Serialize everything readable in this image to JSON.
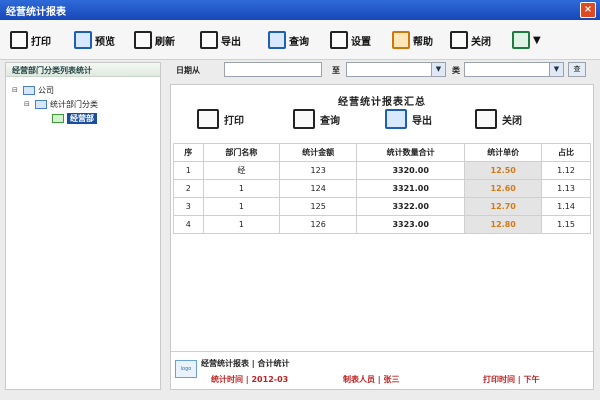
{
  "window": {
    "title": "经营统计报表",
    "close_glyph": "×"
  },
  "toolbar": {
    "buttons": [
      {
        "label": "打印",
        "icon": "print-icon"
      },
      {
        "label": "预览",
        "icon": "preview-icon"
      },
      {
        "label": "刷新",
        "icon": "refresh-icon"
      },
      {
        "label": "导出",
        "icon": "export-icon"
      },
      {
        "label": "查询",
        "icon": "query-icon"
      },
      {
        "label": "设置",
        "icon": "settings-icon"
      },
      {
        "label": "帮助",
        "icon": "help-icon"
      },
      {
        "label": "关闭",
        "icon": "close-doc-icon"
      }
    ]
  },
  "sidebar": {
    "header": "经营部门分类列表统计",
    "tree": [
      {
        "toggle": "⊟",
        "label": "公司",
        "level": 0
      },
      {
        "toggle": "⊟",
        "label": "统计部门分类",
        "level": 1
      },
      {
        "toggle": "",
        "label": "经营部",
        "level": 2,
        "selected": true
      }
    ]
  },
  "filter": {
    "date_label": "日期从",
    "date_value": "",
    "to_label": "至",
    "to_value": "",
    "type_label": "类",
    "type_value": "",
    "dropdown_glyph": "▼",
    "go_label": "查"
  },
  "report": {
    "title": "经营统计报表汇总",
    "actions": [
      {
        "label": "打印",
        "icon": "print-icon"
      },
      {
        "label": "查询",
        "icon": "search-icon"
      },
      {
        "label": "导出",
        "icon": "export-icon"
      },
      {
        "label": "关闭",
        "icon": "close-doc-icon"
      }
    ],
    "columns": [
      "序",
      "部门名称",
      "统计金额",
      "统计数量合计",
      "统计单价",
      "占比"
    ],
    "rows": [
      [
        "1",
        "经",
        "123",
        "3320.00",
        "12.50",
        "1.12"
      ],
      [
        "2",
        "1",
        "124",
        "3321.00",
        "12.60",
        "1.13"
      ],
      [
        "3",
        "1",
        "125",
        "3322.00",
        "12.70",
        "1.14"
      ],
      [
        "4",
        "1",
        "126",
        "3323.00",
        "12.80",
        "1.15"
      ]
    ]
  },
  "footer": {
    "logo": "logo",
    "line1": "经营统计报表 | 合计统计",
    "line2a": "统计时间 | 2012-03",
    "line2b": "制表人员 | 张三",
    "line2c": "打印时间 | 下午"
  }
}
